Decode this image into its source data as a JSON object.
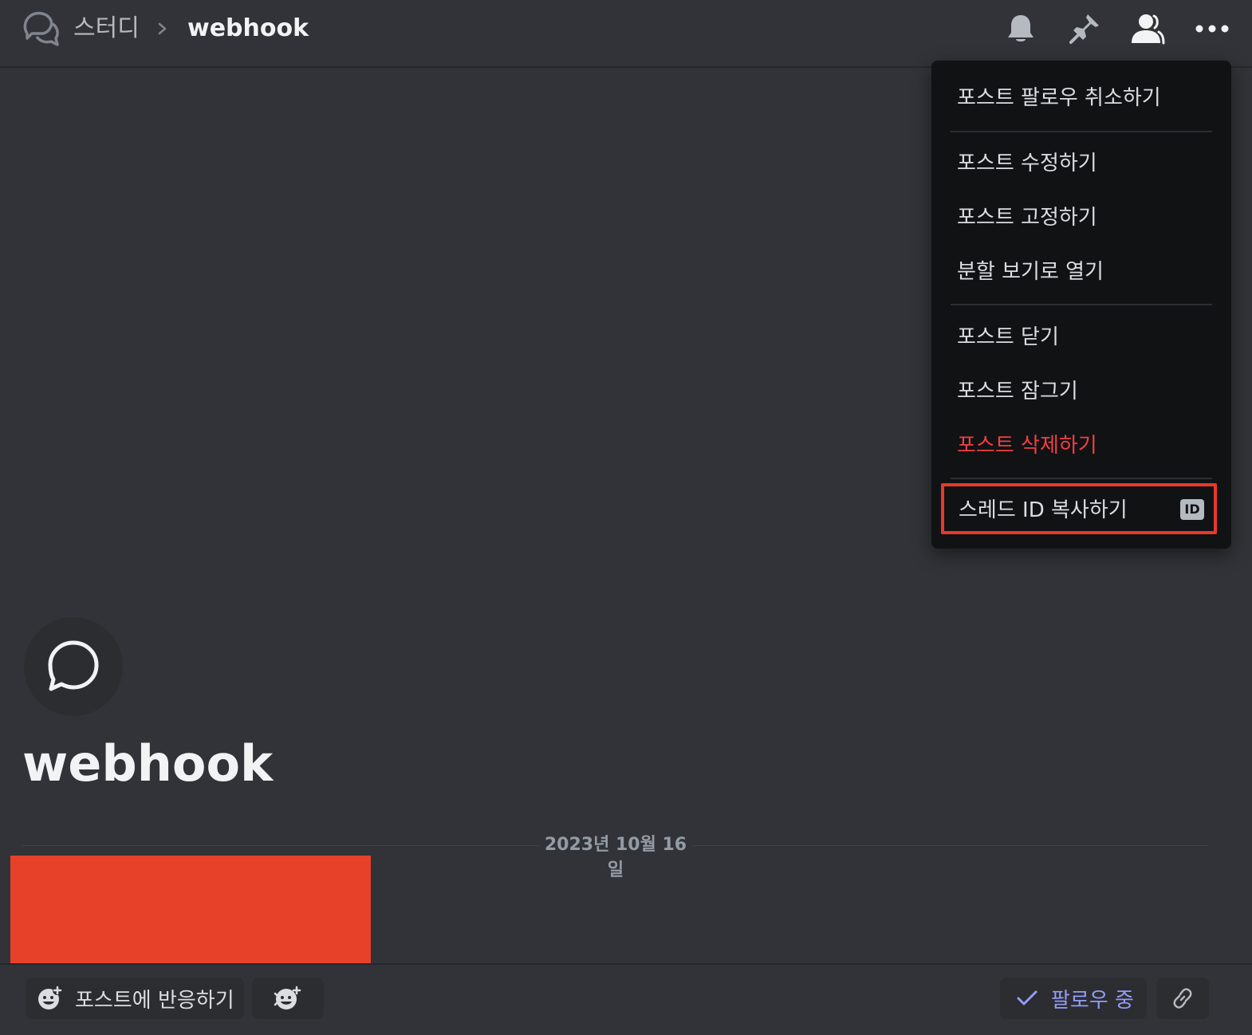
{
  "header": {
    "channel": "스터디",
    "thread": "webhook"
  },
  "icons": {
    "thread": "threads-icon",
    "separator": "chevron-right-icon",
    "notifications": "bell-icon",
    "pins": "pin-icon",
    "members": "members-icon",
    "more": "more-horizontal-icon",
    "post": "speech-bubble-icon",
    "reaction": "add-reaction-icon",
    "super_reaction": "super-reaction-icon",
    "check": "check-icon",
    "link": "link-icon",
    "id": "id-icon"
  },
  "menu": {
    "items": [
      {
        "label": "포스트 팔로우 취소하기",
        "tone": "normal"
      },
      {
        "label": "포스트 수정하기",
        "tone": "normal"
      },
      {
        "label": "포스트 고정하기",
        "tone": "normal"
      },
      {
        "label": "분할 보기로 열기",
        "tone": "normal"
      },
      {
        "label": "포스트 닫기",
        "tone": "normal"
      },
      {
        "label": "포스트 잠그기",
        "tone": "normal"
      },
      {
        "label": "포스트 삭제하기",
        "tone": "danger"
      },
      {
        "label": "스레드 ID 복사하기",
        "tone": "normal",
        "badge": "ID"
      }
    ]
  },
  "post": {
    "title": "webhook",
    "date_divider": "2023년 10월 16일"
  },
  "actions": {
    "react_label": "포스트에 반응하기",
    "follow_label": "팔로우 중"
  },
  "colors": {
    "background": "#313338",
    "menu_background": "#111214",
    "danger": "#f23f42",
    "highlight_border": "#e8392b",
    "following": "#949cf7",
    "redaction": "#e8412a"
  }
}
